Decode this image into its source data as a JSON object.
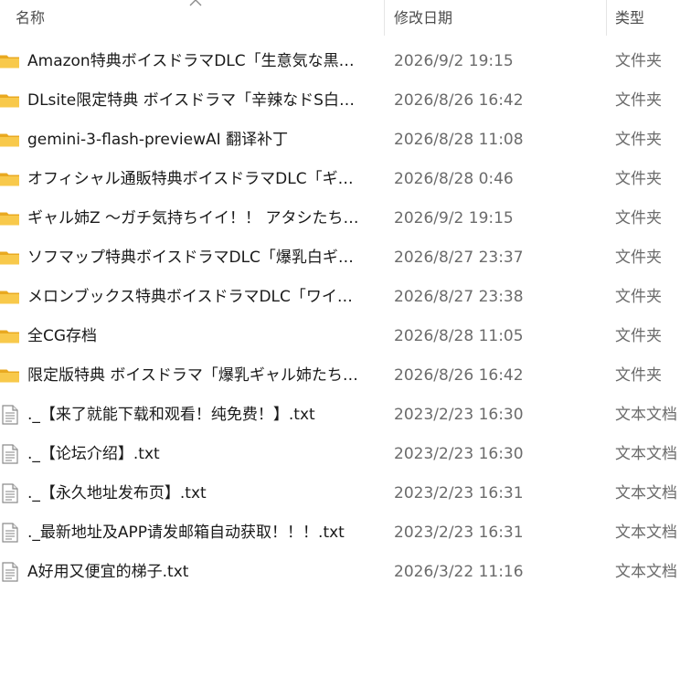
{
  "columns": {
    "name": "名称",
    "date": "修改日期",
    "type": "类型"
  },
  "sort": {
    "column": "name",
    "indicator": "chevron-up-icon"
  },
  "icons": {
    "folder": "folder-icon",
    "text_file": "text-file-icon",
    "folder_color": "#F8C94B",
    "folder_back_color": "#E9A920"
  },
  "files": [
    {
      "kind": "folder",
      "name": "Amazon特典ボイスドラマDLC「生意気な黒…",
      "date": "2026/9/2 19:15",
      "type": "文件夹"
    },
    {
      "kind": "folder",
      "name": "DLsite限定特典 ボイスドラマ「辛辣なドS白…",
      "date": "2026/8/26 16:42",
      "type": "文件夹"
    },
    {
      "kind": "folder",
      "name": "gemini-3-flash-previewAI 翻译补丁",
      "date": "2026/8/28 11:08",
      "type": "文件夹"
    },
    {
      "kind": "folder",
      "name": "オフィシャル通販特典ボイスドラマDLC「ギ…",
      "date": "2026/8/28 0:46",
      "type": "文件夹"
    },
    {
      "kind": "folder",
      "name": "ギャル姉Z ～ガチ気持ちイイ！！ アタシたち…",
      "date": "2026/9/2 19:15",
      "type": "文件夹"
    },
    {
      "kind": "folder",
      "name": "ソフマップ特典ボイスドラマDLC「爆乳白ギ…",
      "date": "2026/8/27 23:37",
      "type": "文件夹"
    },
    {
      "kind": "folder",
      "name": "メロンブックス特典ボイスドラマDLC「ワイ…",
      "date": "2026/8/27 23:38",
      "type": "文件夹"
    },
    {
      "kind": "folder",
      "name": "全CG存档",
      "date": "2026/8/28 11:05",
      "type": "文件夹"
    },
    {
      "kind": "folder",
      "name": "限定版特典 ボイスドラマ「爆乳ギャル姉たち…",
      "date": "2026/8/26 16:42",
      "type": "文件夹"
    },
    {
      "kind": "text_file",
      "name": "._【来了就能下载和观看！纯免费！】.txt",
      "date": "2023/2/23 16:30",
      "type": "文本文档"
    },
    {
      "kind": "text_file",
      "name": "._【论坛介绍】.txt",
      "date": "2023/2/23 16:30",
      "type": "文本文档"
    },
    {
      "kind": "text_file",
      "name": "._【永久地址发布页】.txt",
      "date": "2023/2/23 16:31",
      "type": "文本文档"
    },
    {
      "kind": "text_file",
      "name": "._最新地址及APP请发邮箱自动获取！！！.txt",
      "date": "2023/2/23 16:31",
      "type": "文本文档"
    },
    {
      "kind": "text_file",
      "name": "A好用又便宜的梯子.txt",
      "date": "2026/3/22 11:16",
      "type": "文本文档"
    }
  ]
}
